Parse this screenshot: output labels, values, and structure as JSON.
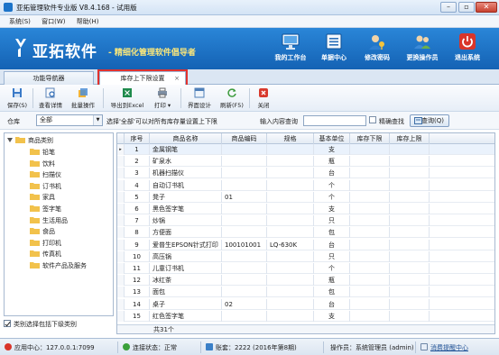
{
  "window": {
    "title": "亚拓管理软件专业版 V8.4.168 - 试用版"
  },
  "menu": [
    "系统(S)",
    "窗口(W)",
    "帮助(H)"
  ],
  "banner": {
    "brand": "亚拓软件",
    "slogan": "- 精细化管理软件倡导者",
    "nav": [
      {
        "label": "我的工作台",
        "icon": "monitor-icon"
      },
      {
        "label": "单据中心",
        "icon": "document-list-icon"
      },
      {
        "label": "修改密码",
        "icon": "key-person-icon"
      },
      {
        "label": "更换操作员",
        "icon": "users-icon"
      },
      {
        "label": "退出系统",
        "icon": "power-icon"
      }
    ]
  },
  "tabs": {
    "nav_tab": "功能导航器",
    "active_tab": "库存上下限设置"
  },
  "toolbar": {
    "save": "保存(S)",
    "view_detail": "查看详情",
    "batch": "批量操作",
    "export_excel": "导出到Excel",
    "print": "打印",
    "ui_design": "界面设计",
    "refresh": "刷新(F5)",
    "close": "关闭"
  },
  "filter": {
    "warehouse_label": "仓库",
    "warehouse_value": "全部",
    "warehouse_hint": "选择'全部'可以对所有库存量设置上下限",
    "query_label": "输入内容查询",
    "query_value": "",
    "exact_label": "精确查找",
    "query_button": "查询(Q)"
  },
  "tree": {
    "root": "商品类别",
    "items": [
      "铅笔",
      "饮料",
      "扫描仪",
      "订书机",
      "家具",
      "签字笔",
      "生活用品",
      "食品",
      "打印机",
      "传真机",
      "软件产品及服务"
    ],
    "include_sub": "类别选择包括下级类别"
  },
  "grid": {
    "headers": [
      "序号",
      "商品名称",
      "商品编码",
      "规格",
      "基本单位",
      "库存下限",
      "库存上限"
    ],
    "rows": [
      [
        "1",
        "金属钢笔",
        "",
        "",
        "支",
        "",
        ""
      ],
      [
        "2",
        "矿泉水",
        "",
        "",
        "瓶",
        "",
        ""
      ],
      [
        "3",
        "机器扫描仪",
        "",
        "",
        "台",
        "",
        ""
      ],
      [
        "4",
        "自动订书机",
        "",
        "",
        "个",
        "",
        ""
      ],
      [
        "5",
        "凳子",
        "01",
        "",
        "个",
        "",
        ""
      ],
      [
        "6",
        "黑色签字笔",
        "",
        "",
        "支",
        "",
        ""
      ],
      [
        "7",
        "炒锅",
        "",
        "",
        "只",
        "",
        ""
      ],
      [
        "8",
        "方便面",
        "",
        "",
        "包",
        "",
        ""
      ],
      [
        "9",
        "爱普生EPSON针式打印",
        "100101001",
        "LQ-630K",
        "台",
        "",
        ""
      ],
      [
        "10",
        "高压锅",
        "",
        "",
        "只",
        "",
        ""
      ],
      [
        "11",
        "儿童订书机",
        "",
        "",
        "个",
        "",
        ""
      ],
      [
        "12",
        "冰红茶",
        "",
        "",
        "瓶",
        "",
        ""
      ],
      [
        "13",
        "面包",
        "",
        "",
        "包",
        "",
        ""
      ],
      [
        "14",
        "桌子",
        "02",
        "",
        "台",
        "",
        ""
      ],
      [
        "15",
        "红色签字笔",
        "",
        "",
        "支",
        "",
        ""
      ]
    ],
    "footer": "共31个"
  },
  "status": {
    "app_center": "应用中心：127.0.0.1:7099",
    "connection": "连接状态：正常",
    "account_set": "账套：2222 (2016年第8期)",
    "operator": "操作员：系统管理员 (admin)",
    "messages": "消费提醒中心"
  },
  "colors": {
    "banner": "#1f74c8",
    "slogan": "#fbe77a",
    "active_tab_outline": "#e0322f"
  }
}
